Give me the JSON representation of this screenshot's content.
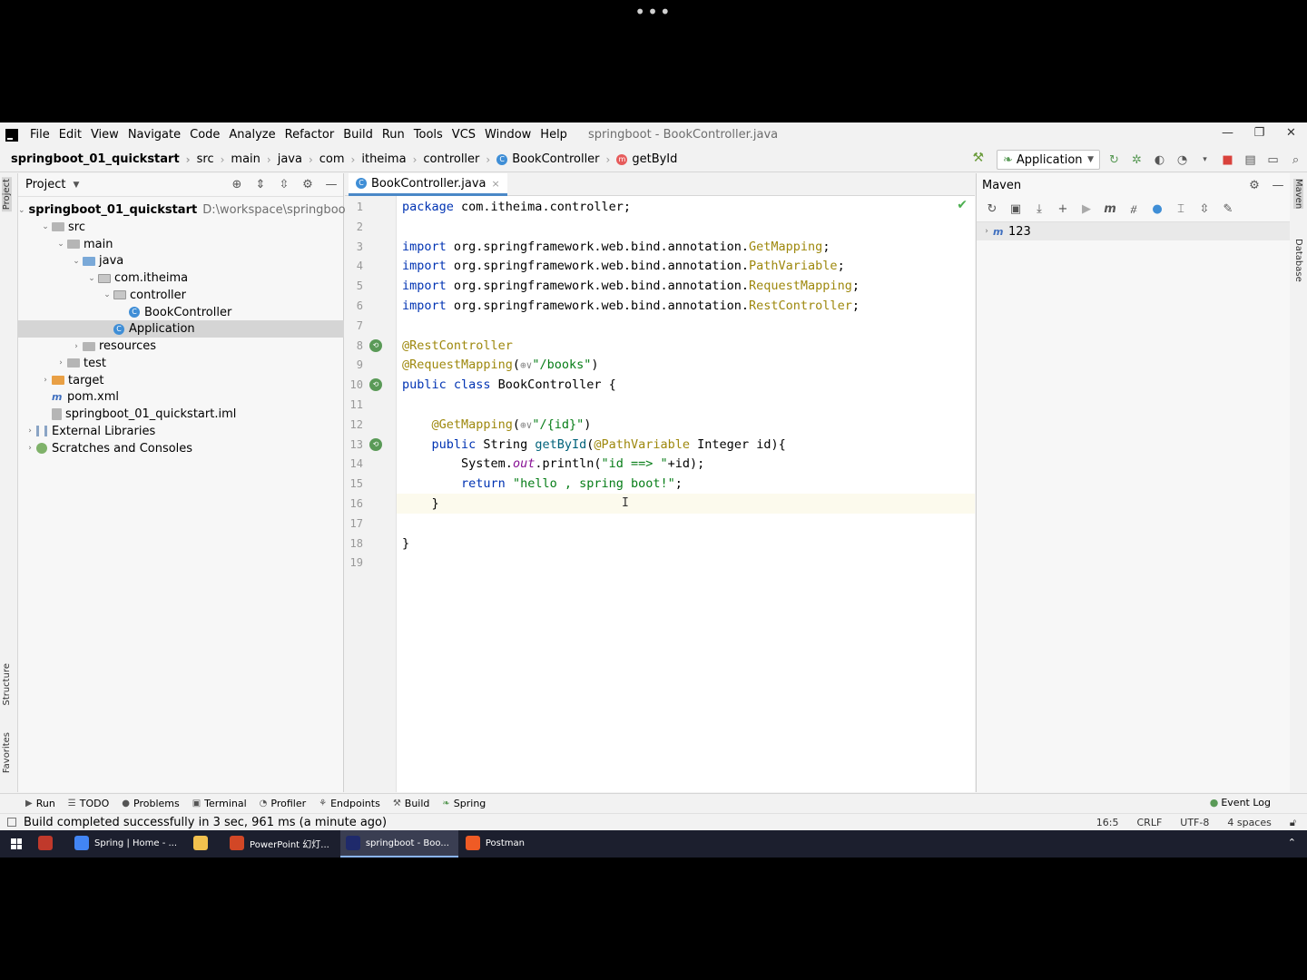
{
  "top": {
    "dots": "•••"
  },
  "menubar": {
    "items": [
      "File",
      "Edit",
      "View",
      "Navigate",
      "Code",
      "Analyze",
      "Refactor",
      "Build",
      "Run",
      "Tools",
      "VCS",
      "Window",
      "Help"
    ],
    "window_title": "springboot - BookController.java",
    "controls": [
      "—",
      "❐",
      "✕"
    ]
  },
  "breadcrumb": {
    "items": [
      "springboot_01_quickstart",
      "src",
      "main",
      "java",
      "com",
      "itheima",
      "controller",
      "BookController",
      "getById"
    ]
  },
  "run_config": {
    "label": "Application"
  },
  "project_panel": {
    "title": "Project",
    "tree": [
      {
        "label": "springboot_01_quickstart",
        "hint": "D:\\workspace\\springboot\\s",
        "level": 0,
        "expanded": true,
        "kind": "module",
        "bold": true
      },
      {
        "label": "src",
        "level": 1,
        "expanded": true,
        "kind": "folder"
      },
      {
        "label": "main",
        "level": 2,
        "expanded": true,
        "kind": "folder"
      },
      {
        "label": "java",
        "level": 3,
        "expanded": true,
        "kind": "folder-blue"
      },
      {
        "label": "com.itheima",
        "level": 4,
        "expanded": true,
        "kind": "package"
      },
      {
        "label": "controller",
        "level": 5,
        "expanded": true,
        "kind": "package"
      },
      {
        "label": "BookController",
        "level": 6,
        "kind": "class"
      },
      {
        "label": "Application",
        "level": 5,
        "kind": "class",
        "selected": true
      },
      {
        "label": "resources",
        "level": 3,
        "expanded": false,
        "kind": "folder"
      },
      {
        "label": "test",
        "level": 2,
        "expanded": false,
        "kind": "folder"
      },
      {
        "label": "target",
        "level": 1,
        "expanded": false,
        "kind": "folder-orange"
      },
      {
        "label": "pom.xml",
        "level": 1,
        "kind": "maven"
      },
      {
        "label": "springboot_01_quickstart.iml",
        "level": 1,
        "kind": "file"
      },
      {
        "label": "External Libraries",
        "level": 0,
        "expanded": false,
        "kind": "lib"
      },
      {
        "label": "Scratches and Consoles",
        "level": 0,
        "expanded": false,
        "kind": "scratch"
      }
    ]
  },
  "editor": {
    "tab": "BookController.java",
    "lines": [
      "1",
      "2",
      "3",
      "4",
      "5",
      "6",
      "7",
      "8",
      "9",
      "10",
      "11",
      "12",
      "13",
      "14",
      "15",
      "16",
      "17",
      "18",
      "19"
    ],
    "code": {
      "l1": [
        "package",
        " com.itheima.controller;"
      ],
      "l3": [
        "import",
        " org.springframework.web.bind.annotation.",
        "GetMapping",
        ";"
      ],
      "l4": [
        "import",
        " org.springframework.web.bind.annotation.",
        "PathVariable",
        ";"
      ],
      "l5": [
        "import",
        " org.springframework.web.bind.annotation.",
        "RequestMapping",
        ";"
      ],
      "l6": [
        "import",
        " org.springframework.web.bind.annotation.",
        "RestController",
        ";"
      ],
      "l8": [
        "@RestController"
      ],
      "l9": [
        "@RequestMapping",
        "(",
        "⊕∨",
        "\"/books\"",
        ")"
      ],
      "l10": [
        "public class",
        " BookController {"
      ],
      "l12": [
        "@GetMapping",
        "(",
        "⊕∨",
        "\"/{id}\"",
        ")"
      ],
      "l13": [
        "public",
        " String ",
        "getById",
        "(",
        "@PathVariable",
        " Integer id){"
      ],
      "l14": [
        "System.",
        "out",
        ".println(",
        "\"id ==> \"",
        "+id);"
      ],
      "l15": [
        "return",
        " ",
        "\"hello , spring boot!\"",
        ";"
      ],
      "l16": [
        "}"
      ],
      "l18": [
        "}"
      ]
    }
  },
  "maven_panel": {
    "title": "Maven",
    "tree": [
      {
        "label": "123"
      }
    ]
  },
  "side_labels": {
    "project": "Project",
    "structure": "Structure",
    "favorites": "Favorites",
    "maven": "Maven",
    "database": "Database"
  },
  "tool_windows": [
    "Run",
    "TODO",
    "Problems",
    "Terminal",
    "Profiler",
    "Endpoints",
    "Build",
    "Spring"
  ],
  "event_log": "Event Log",
  "status": {
    "message": "Build completed successfully in 3 sec, 961 ms (a minute ago)",
    "position": "16:5",
    "line_sep": "CRLF",
    "encoding": "UTF-8",
    "indent": "4 spaces"
  },
  "taskbar": {
    "items": [
      {
        "label": "",
        "color": "#c0392b"
      },
      {
        "label": "Spring | Home - ...",
        "color": "#4285f4"
      },
      {
        "label": "",
        "color": "#f2c14e"
      },
      {
        "label": "PowerPoint 幻灯...",
        "color": "#d24726"
      },
      {
        "label": "springboot - Boo...",
        "color": "#1f2a6b",
        "active": true
      },
      {
        "label": "Postman",
        "color": "#ef5b25"
      }
    ],
    "tray": "⌃"
  }
}
